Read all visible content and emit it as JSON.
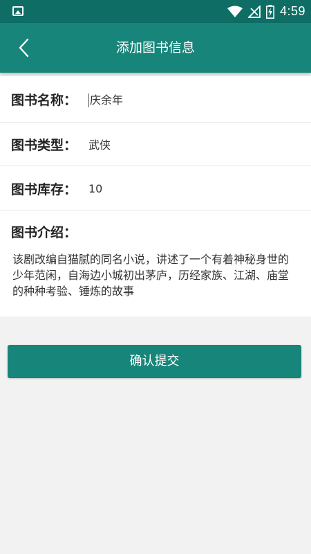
{
  "status_bar": {
    "time": "4:59",
    "icons": [
      "image-icon",
      "wifi-icon",
      "no-signal-icon",
      "battery-charging-icon"
    ]
  },
  "app_bar": {
    "title": "添加图书信息",
    "back_icon": "chevron-left-icon"
  },
  "form": {
    "name": {
      "label": "图书名称：",
      "value": "庆余年"
    },
    "type": {
      "label": "图书类型：",
      "value": "武侠"
    },
    "stock": {
      "label": "图书库存：",
      "value": "10"
    },
    "intro": {
      "label": "图书介绍：",
      "value": "该剧改编自猫腻的同名小说，讲述了一个有着神秘身世的少年范闲，自海边小城初出茅庐，历经家族、江湖、庙堂的种种考验、锤炼的故事"
    }
  },
  "submit_label": "确认提交",
  "colors": {
    "status_bar": "#0e6e66",
    "app_bar": "#17857a",
    "button": "#17857a",
    "background": "#f2f2f2"
  }
}
